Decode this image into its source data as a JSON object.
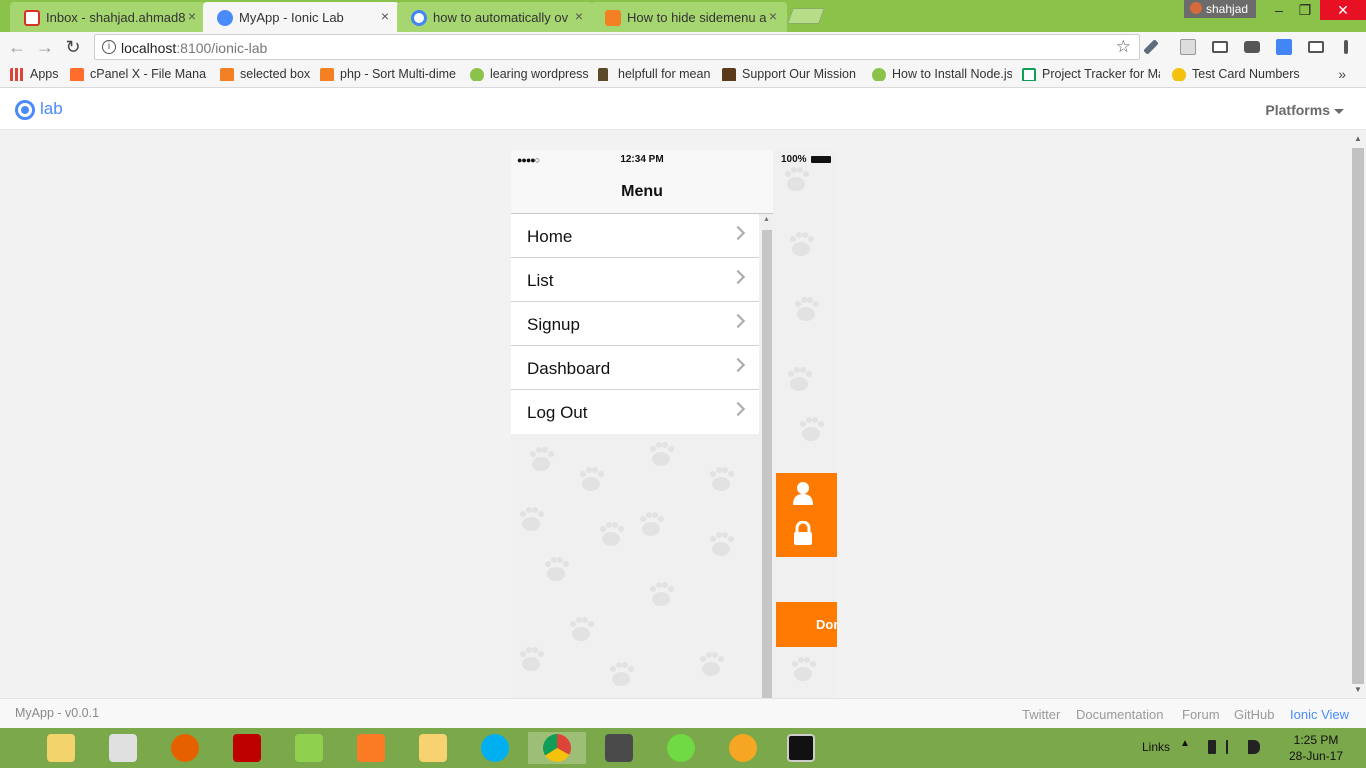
{
  "browser": {
    "tabs": [
      {
        "title": "Inbox - shahjad.ahmad8",
        "favicon_color": "#d93025",
        "active": false
      },
      {
        "title": "MyApp - Ionic Lab",
        "favicon_color": "#4a8bfc",
        "active": true
      },
      {
        "title": "how to automatically ov",
        "favicon_color": "#4285f4",
        "active": false
      },
      {
        "title": "How to hide sidemenu a",
        "favicon_color": "#f48024",
        "active": false
      }
    ],
    "tab_close_glyph": "×",
    "profile_name": "shahjad",
    "window_controls": {
      "minimize": "–",
      "restore": "❐",
      "close": "✕"
    },
    "address": {
      "host": "localhost",
      "path": ":8100/ionic-lab",
      "info_glyph": "i",
      "star_glyph": "☆"
    },
    "nav": {
      "back": "←",
      "forward": "→",
      "reload": "↻"
    },
    "bookmarks": [
      {
        "label": "Apps",
        "color": "#db4437"
      },
      {
        "label": "cPanel X - File Manag",
        "color": "#ff6c2c"
      },
      {
        "label": "selected box",
        "color": "#f48024"
      },
      {
        "label": "php - Sort Multi-dime",
        "color": "#f48024"
      },
      {
        "label": "learing wordpress",
        "color": "#8bc34a"
      },
      {
        "label": "helpfull for mean",
        "color": "#5a4a2a"
      },
      {
        "label": "Support Our Mission |",
        "color": "#5a3a1a"
      },
      {
        "label": "How to Install Node.js",
        "color": "#8bc34a"
      },
      {
        "label": "Project Tracker for Ma",
        "color": "#0f9d58"
      },
      {
        "label": "Test Card Numbers",
        "color": "#f4c20d"
      }
    ],
    "bookmarks_more": "»"
  },
  "lab": {
    "logo_text": "lab",
    "platforms_label": "Platforms",
    "version": "MyApp - v0.0.1",
    "footer_links": [
      "Twitter",
      "Documentation",
      "Forum",
      "GitHub",
      "Ionic View"
    ],
    "active_footer_link": "Ionic View"
  },
  "phone": {
    "status": {
      "signal": "●●●●○",
      "time": "12:34 PM",
      "battery": "100%"
    },
    "menu_title": "Menu",
    "menu_items": [
      "Home",
      "List",
      "Signup",
      "Dashboard",
      "Log Out"
    ],
    "done_label": "Dor",
    "accent_color": "#ff7a00"
  },
  "taskbar": {
    "apps": [
      {
        "name": "explorer-folders",
        "color": "#f3d36b"
      },
      {
        "name": "reader",
        "color": "#e0e0e0"
      },
      {
        "name": "firefox",
        "color": "#e66000"
      },
      {
        "name": "filezilla",
        "color": "#bf0000"
      },
      {
        "name": "notepad-plus",
        "color": "#8fd14f"
      },
      {
        "name": "xampp",
        "color": "#fb7a24"
      },
      {
        "name": "file-explorer",
        "color": "#f6d271"
      },
      {
        "name": "skype",
        "color": "#00aff0"
      },
      {
        "name": "chrome",
        "color": "#4285f4"
      },
      {
        "name": "sublime-text",
        "color": "#4a4a4a"
      },
      {
        "name": "upwork",
        "color": "#6fda44"
      },
      {
        "name": "paint",
        "color": "#f5a623"
      },
      {
        "name": "command-prompt",
        "color": "#111111"
      }
    ],
    "links_label": "Links",
    "tray_up": "▲",
    "clock_time": "1:25 PM",
    "clock_date": "28-Jun-17"
  }
}
